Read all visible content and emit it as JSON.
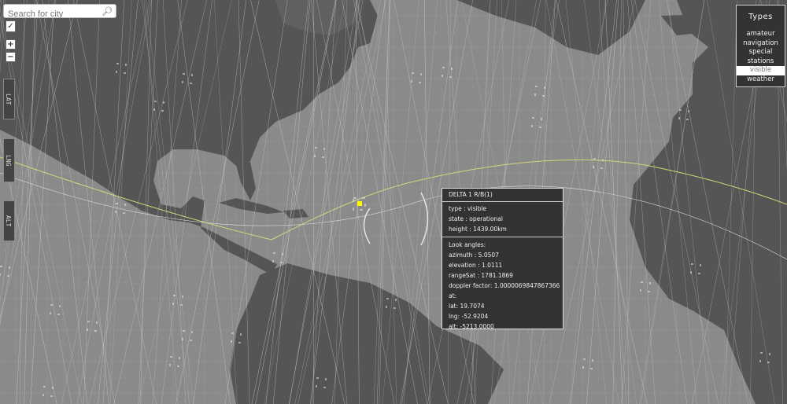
{
  "search": {
    "placeholder": "Search for city",
    "icon": "search-icon"
  },
  "controls": {
    "check": "✓",
    "zoom_in": "+",
    "zoom_out": "−"
  },
  "coords": {
    "lat": "LAT 19.7074",
    "lng": "LNG -52.9204",
    "alt": "ALT -5213.0"
  },
  "types": {
    "title": "Types",
    "items": [
      "amateur",
      "navigation",
      "special",
      "stations",
      "visible",
      "weather"
    ],
    "selected": "visible"
  },
  "info": {
    "name": "DELTA 1 R/B(1)",
    "type": "type : visible",
    "state": "state : operational",
    "height": "height : 1439.00km",
    "look_title": "Look angles:",
    "azimuth": "azimuth : 5.0507",
    "elevation": "elevation : 1.0111",
    "range": "rangeSat : 1781.1869",
    "doppler": "doppler factor: 1.0000069847867366",
    "at": "at:",
    "lat": "lat: 19.7074",
    "lng": "lng: -52.9204",
    "alt": "alt: -5213.0000"
  },
  "colors": {
    "ocean": "#8a8a8a",
    "land": "#555555",
    "orbit": "#d6d67a",
    "satellite": "#ffff00",
    "tracks": "#c8c8c8"
  }
}
